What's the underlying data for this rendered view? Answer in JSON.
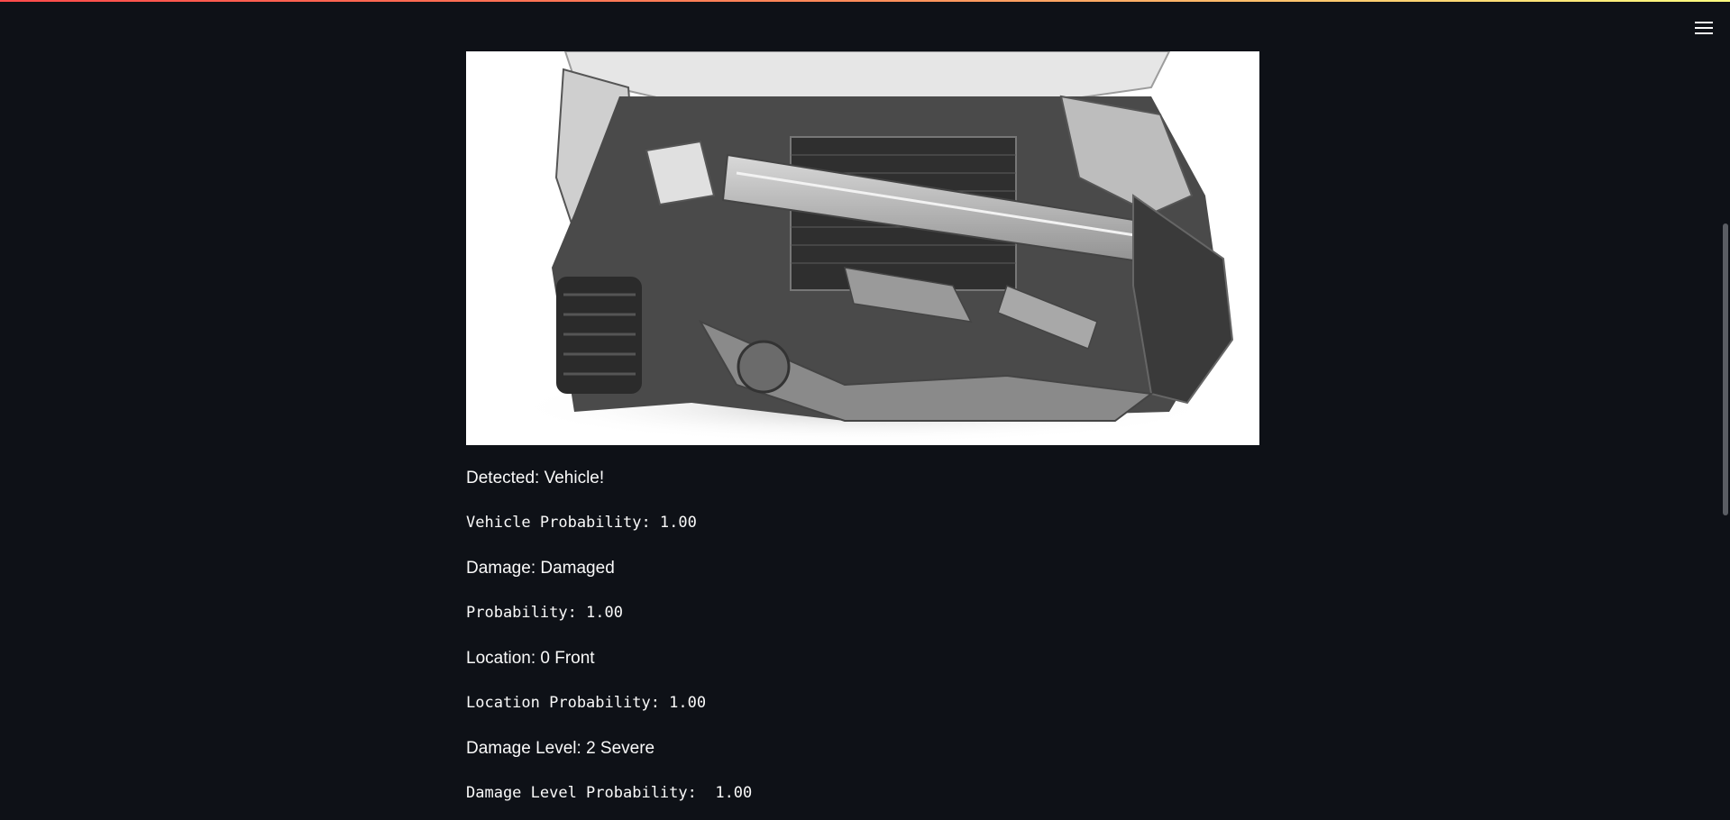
{
  "header": {
    "menu_icon": "hamburger-menu-icon",
    "accent_gradient": [
      "#ff4b4b",
      "#fffd80"
    ]
  },
  "theme": {
    "background": "#0e1117",
    "text": "#fafafa"
  },
  "image": {
    "alt": "damaged car front",
    "icon": "wrecked-car-photo"
  },
  "results": {
    "detected": "Detected: Vehicle!",
    "vehicle_probability": "Vehicle Probability: 1.00",
    "damage": "Damage: Damaged",
    "damage_probability": "Probability: 1.00",
    "location": "Location: 0 Front",
    "location_probability": "Location Probability: 1.00",
    "damage_level": "Damage Level: 2 Severe",
    "damage_level_probability": "Damage Level Probability:  1.00"
  }
}
